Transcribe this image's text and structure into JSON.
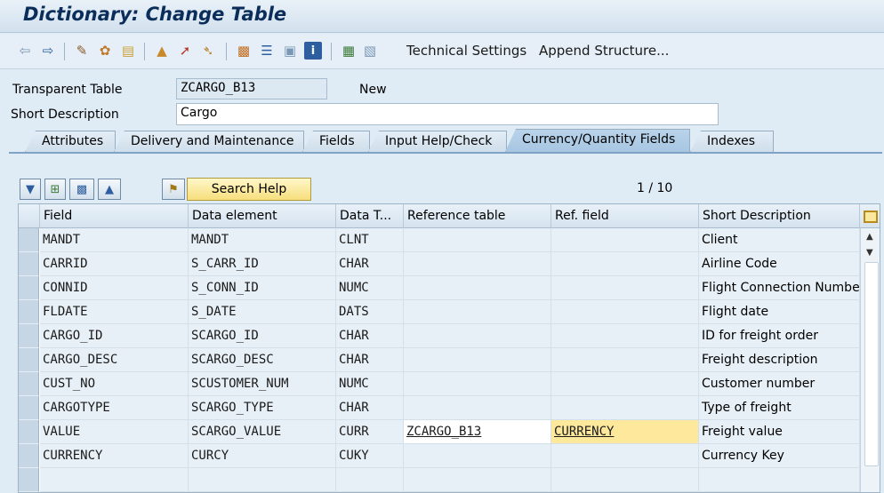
{
  "window": {
    "title": "Dictionary: Change Table"
  },
  "toolbar": {
    "icons": [
      "back-arrow-icon",
      "forward-arrow-icon",
      "display-change-icon",
      "other-object-icon",
      "check-icon",
      "activate-icon",
      "where-used-icon",
      "navigate-icon",
      "hierarchy-icon",
      "object-list-icon",
      "info-icon",
      "layout-icon",
      "grid-icon"
    ],
    "technical_settings": "Technical Settings",
    "append_structure": "Append Structure..."
  },
  "header": {
    "table_type_label": "Transparent Table",
    "table_name": "ZCARGO_B13",
    "status": "New",
    "short_desc_label": "Short Description",
    "short_desc_value": "Cargo"
  },
  "tabs": [
    {
      "label": "Attributes"
    },
    {
      "label": "Delivery and Maintenance"
    },
    {
      "label": "Fields"
    },
    {
      "label": "Input Help/Check"
    },
    {
      "label": "Currency/Quantity Fields",
      "active": true
    },
    {
      "label": "Indexes"
    }
  ],
  "table_toolbar": {
    "search_help": "Search Help",
    "pager": "1 / 10"
  },
  "columns": [
    "Field",
    "Data element",
    "Data T...",
    "Reference table",
    "Ref. field",
    "Short Description"
  ],
  "rows": [
    {
      "field": "MANDT",
      "element": "MANDT",
      "dtype": "CLNT",
      "ref_table": "",
      "ref_field": "",
      "desc": "Client"
    },
    {
      "field": "CARRID",
      "element": "S_CARR_ID",
      "dtype": "CHAR",
      "ref_table": "",
      "ref_field": "",
      "desc": "Airline Code"
    },
    {
      "field": "CONNID",
      "element": "S_CONN_ID",
      "dtype": "NUMC",
      "ref_table": "",
      "ref_field": "",
      "desc": "Flight Connection Numbe"
    },
    {
      "field": "FLDATE",
      "element": "S_DATE",
      "dtype": "DATS",
      "ref_table": "",
      "ref_field": "",
      "desc": "Flight date"
    },
    {
      "field": "CARGO_ID",
      "element": "SCARGO_ID",
      "dtype": "CHAR",
      "ref_table": "",
      "ref_field": "",
      "desc": "ID for freight order"
    },
    {
      "field": "CARGO_DESC",
      "element": "SCARGO_DESC",
      "dtype": "CHAR",
      "ref_table": "",
      "ref_field": "",
      "desc": "Freight description"
    },
    {
      "field": "CUST_NO",
      "element": "SCUSTOMER_NUM",
      "dtype": "NUMC",
      "ref_table": "",
      "ref_field": "",
      "desc": "Customer number"
    },
    {
      "field": "CARGOTYPE",
      "element": "SCARGO_TYPE",
      "dtype": "CHAR",
      "ref_table": "",
      "ref_field": "",
      "desc": "Type of freight"
    },
    {
      "field": "VALUE",
      "element": "SCARGO_VALUE",
      "dtype": "CURR",
      "ref_table": "ZCARGO_B13",
      "ref_field": "CURRENCY",
      "desc": "Freight value"
    },
    {
      "field": "CURRENCY",
      "element": "CURCY",
      "dtype": "CUKY",
      "ref_table": "",
      "ref_field": "",
      "desc": "Currency Key"
    },
    {
      "field": "",
      "element": "",
      "dtype": "",
      "ref_table": "",
      "ref_field": "",
      "desc": ""
    }
  ]
}
